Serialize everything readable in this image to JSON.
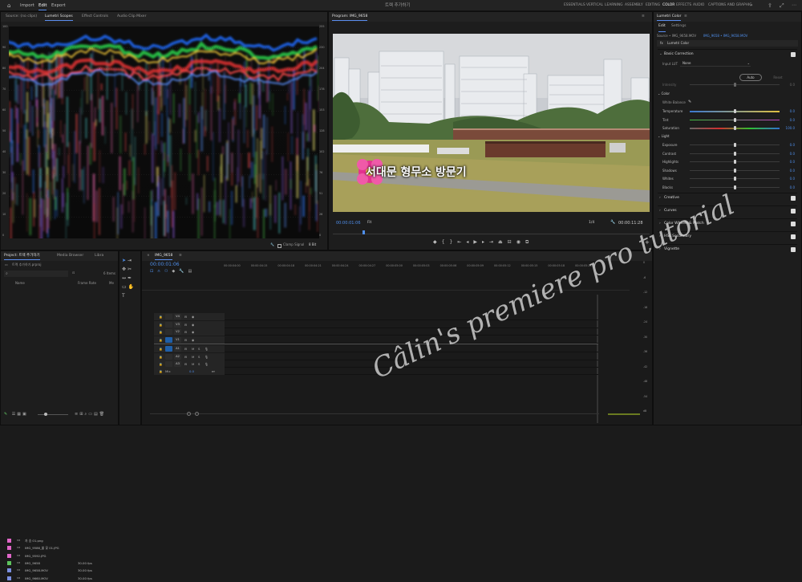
{
  "colors": {
    "accent": "#5a8dee",
    "value_blue": "#4f8eea",
    "timecode": "#4f8eea",
    "red_level": "#c0392b",
    "green_level": "#4caf50"
  },
  "topbar": {
    "nav": [
      "Import",
      "Edit",
      "Export"
    ],
    "active_nav": "Edit",
    "title": "트렉 추가하기",
    "workspaces": [
      "ESSENTIALS",
      "VERTICAL",
      "LEARNING",
      "ASSEMBLY",
      "EDITING",
      "COLOR",
      "EFFECTS",
      "AUDIO",
      "CAPTIONS AND GRAPHIC"
    ],
    "active_workspace": "COLOR"
  },
  "source_panel": {
    "tabs": [
      "Source: (no clips)",
      "Lumetri Scopes",
      "Effect Controls",
      "Audio Clip Mixer"
    ],
    "active_tab": "Lumetri Scopes",
    "left_scale": [
      "100",
      "90",
      "80",
      "70",
      "60",
      "50",
      "40",
      "30",
      "20",
      "10",
      "0"
    ],
    "right_scale": [
      "255",
      "230",
      "204",
      "178",
      "153",
      "128",
      "102",
      "76",
      "51",
      "26",
      "0"
    ],
    "clamp_label": "Clamp Signal",
    "bit_depth": "8 Bit"
  },
  "program_panel": {
    "title": "Program: IMG_9658",
    "caption": "서대문 형무소 방문기",
    "timecode": "00:00:01:06",
    "fit": "Fit",
    "quality": "1/4",
    "duration": "00:00:11:28"
  },
  "lumetri": {
    "title": "Lumetri Color",
    "tabs": [
      "Edit",
      "Settings"
    ],
    "source_line": "Source • IMG_9658.MOV",
    "source_link": "IMG_9658 • IMG_9658.MOV",
    "effect_name": "Lumetri Color",
    "sections": [
      "Basic Correction",
      "Creative",
      "Curves",
      "Color Wheels & Match",
      "HSL Secondary",
      "Vignette"
    ],
    "input_lut_label": "Input LUT",
    "input_lut_value": "None",
    "auto_label": "Auto",
    "reset_label": "Reset",
    "intensity_label": "Intensity",
    "intensity_value": "0.0",
    "color_header": "Color",
    "white_balance_label": "White Balance",
    "color_sliders": [
      {
        "name": "Temperature",
        "value": "0.0",
        "pos": 0.5
      },
      {
        "name": "Tint",
        "value": "0.0",
        "pos": 0.5
      },
      {
        "name": "Saturation",
        "value": "100.0",
        "pos": 0.5
      }
    ],
    "light_header": "Light",
    "light_sliders": [
      {
        "name": "Exposure",
        "value": "0.0",
        "pos": 0.5
      },
      {
        "name": "Contrast",
        "value": "0.0",
        "pos": 0.5
      },
      {
        "name": "Highlights",
        "value": "0.0",
        "pos": 0.5
      },
      {
        "name": "Shadows",
        "value": "0.0",
        "pos": 0.5
      },
      {
        "name": "Whites",
        "value": "0.0",
        "pos": 0.5
      },
      {
        "name": "Blacks",
        "value": "0.0",
        "pos": 0.5
      }
    ]
  },
  "project_panel": {
    "tabs": [
      "Project: 트렉 추가하기",
      "Media Browser",
      "Libra"
    ],
    "project_file": "트렉 추가하기.prproj",
    "item_count": "6 Items",
    "columns": [
      "Name",
      "Frame Rate",
      "Me"
    ],
    "items": [
      {
        "name": "자 승 01.png",
        "rate": "",
        "color": "#e066c8"
      },
      {
        "name": "IMG_9586_불 꽃 01.JPG",
        "rate": "",
        "color": "#e066c8"
      },
      {
        "name": "IMG_9592.JPG",
        "rate": "",
        "color": "#e066c8"
      },
      {
        "name": "IMG_9658",
        "rate": "30.00 fps",
        "color": "#5dc35d"
      },
      {
        "name": "IMG_9658.MOV",
        "rate": "30.00 fps",
        "color": "#7b8fe0"
      },
      {
        "name": "IMG_9660.MOV",
        "rate": "30.00 fps",
        "color": "#7b8fe0"
      }
    ]
  },
  "timeline": {
    "sequence": "IMG_9658",
    "timecode": "00:00:01:06",
    "ruler": [
      "00:00:04:00",
      "00:00:04:15",
      "00:00:04:18",
      "00:00:04:21",
      "00:00:04:24",
      "00:00:04:27",
      "00:00:05:00",
      "00:00:05:03",
      "00:00:05:06",
      "00:00:05:09",
      "00:00:05:12",
      "00:00:05:15",
      "00:00:05:18",
      "00:00:05:21"
    ],
    "video_tracks": [
      "V4",
      "V3",
      "V2",
      "V1"
    ],
    "audio_tracks": [
      "A1",
      "A2",
      "A3"
    ],
    "mix_label": "Mix",
    "mix_value": "0.0",
    "watermark": "Câlin's premiere pro tutorial"
  },
  "meter_scale": [
    "0",
    "-6",
    "-12",
    "-18",
    "-24",
    "-30",
    "-36",
    "-42",
    "-48",
    "-54",
    "dB"
  ]
}
